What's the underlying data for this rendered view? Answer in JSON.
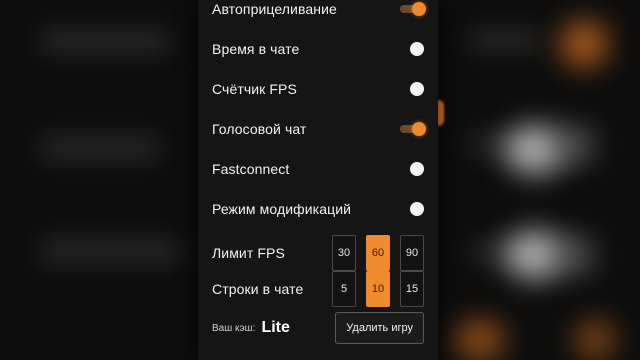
{
  "settings": {
    "items": [
      {
        "label": "Автоприцеливание",
        "state": "on"
      },
      {
        "label": "Время в чате",
        "state": "off"
      },
      {
        "label": "Счётчик FPS",
        "state": "off"
      },
      {
        "label": "Голосовой чат",
        "state": "on"
      },
      {
        "label": "Fastconnect",
        "state": "off"
      },
      {
        "label": "Режим модификаций",
        "state": "off"
      }
    ],
    "fps_limit": {
      "label": "Лимит FPS",
      "options": [
        "30",
        "60",
        "90"
      ],
      "selected": "60"
    },
    "chat_lines": {
      "label": "Строки в чате",
      "options": [
        "5",
        "10",
        "15"
      ],
      "selected": "10"
    }
  },
  "footer": {
    "cache_label": "Ваш кэш:",
    "cache_value": "Lite",
    "delete_button": "Удалить игру"
  },
  "colors": {
    "accent": "#f08a2e",
    "panel": "#151515"
  }
}
